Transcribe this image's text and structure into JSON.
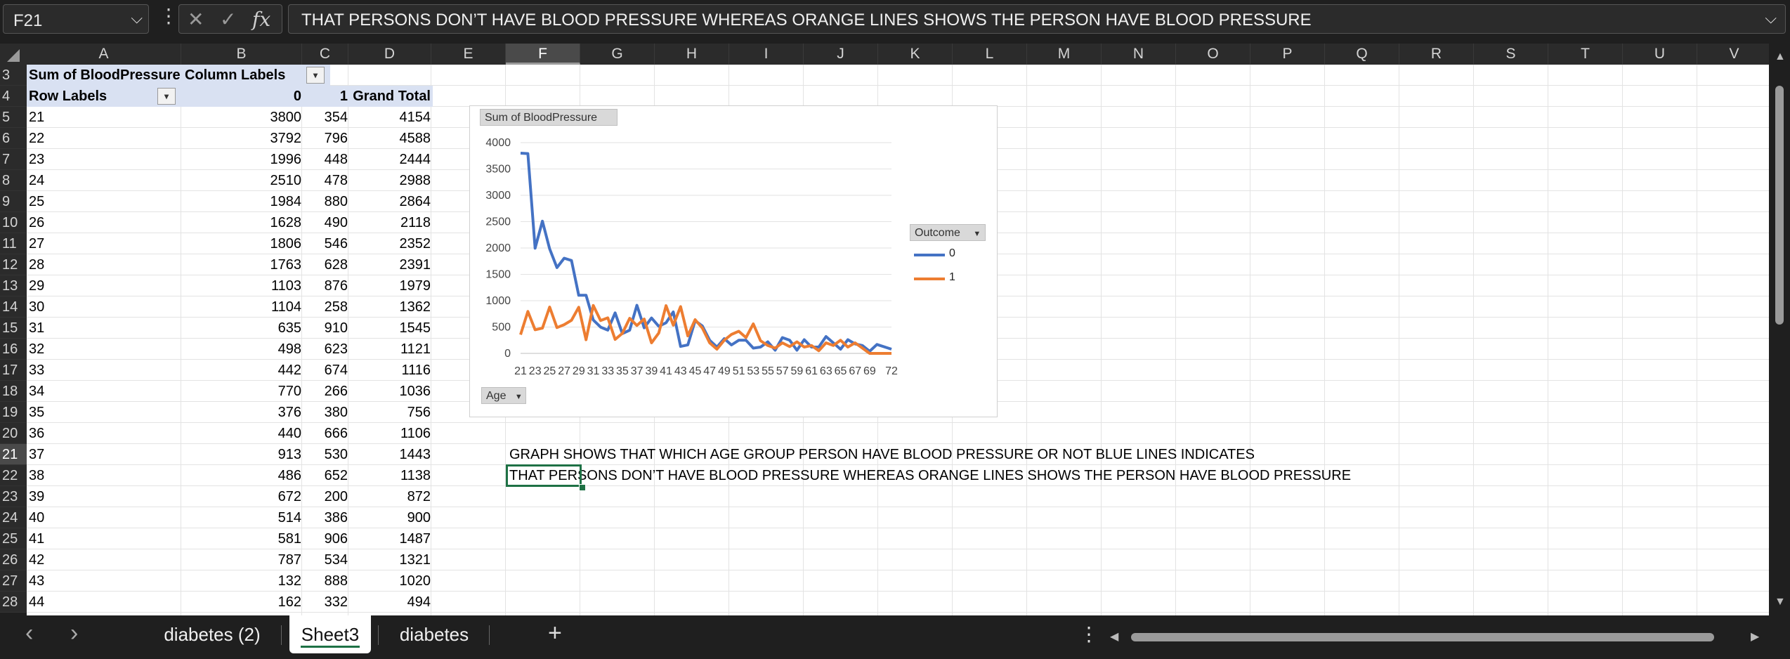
{
  "formula_bar": {
    "name_box": "F21",
    "chevron": "⌵",
    "dots": "⋮",
    "cancel_icon": "✕",
    "enter_icon": "✓",
    "fx_label": "fx",
    "formula_text": "THAT PERSONS DON’T HAVE BLOOD PRESSURE WHEREAS ORANGE LINES SHOWS THE PERSON HAVE BLOOD PRESSURE",
    "formula_chevron": "⌵"
  },
  "columns": [
    "A",
    "B",
    "C",
    "D",
    "E",
    "F",
    "G",
    "H",
    "I",
    "J",
    "K",
    "L",
    "M",
    "N",
    "O",
    "P",
    "Q",
    "R",
    "S",
    "T",
    "U",
    "V"
  ],
  "row_numbers": [
    "3",
    "4",
    "5",
    "6",
    "7",
    "8",
    "9",
    "10",
    "11",
    "12",
    "13",
    "14",
    "15",
    "16",
    "17",
    "18",
    "19",
    "20",
    "21",
    "22",
    "23",
    "24",
    "25",
    "26",
    "27",
    "28"
  ],
  "pivot": {
    "title": "Sum of BloodPressure",
    "column_labels": "Column Labels",
    "row_labels": "Row Labels",
    "col0": "0",
    "col1": "1",
    "grand_total": "Grand Total",
    "rows": [
      [
        "21",
        "3800",
        "354",
        "4154"
      ],
      [
        "22",
        "3792",
        "796",
        "4588"
      ],
      [
        "23",
        "1996",
        "448",
        "2444"
      ],
      [
        "24",
        "2510",
        "478",
        "2988"
      ],
      [
        "25",
        "1984",
        "880",
        "2864"
      ],
      [
        "26",
        "1628",
        "490",
        "2118"
      ],
      [
        "27",
        "1806",
        "546",
        "2352"
      ],
      [
        "28",
        "1763",
        "628",
        "2391"
      ],
      [
        "29",
        "1103",
        "876",
        "1979"
      ],
      [
        "30",
        "1104",
        "258",
        "1362"
      ],
      [
        "31",
        "635",
        "910",
        "1545"
      ],
      [
        "32",
        "498",
        "623",
        "1121"
      ],
      [
        "33",
        "442",
        "674",
        "1116"
      ],
      [
        "34",
        "770",
        "266",
        "1036"
      ],
      [
        "35",
        "376",
        "380",
        "756"
      ],
      [
        "36",
        "440",
        "666",
        "1106"
      ],
      [
        "37",
        "913",
        "530",
        "1443"
      ],
      [
        "38",
        "486",
        "652",
        "1138"
      ],
      [
        "39",
        "672",
        "200",
        "872"
      ],
      [
        "40",
        "514",
        "386",
        "900"
      ],
      [
        "41",
        "581",
        "906",
        "1487"
      ],
      [
        "42",
        "787",
        "534",
        "1321"
      ],
      [
        "43",
        "132",
        "888",
        "1020"
      ],
      [
        "44",
        "162",
        "332",
        "494"
      ]
    ]
  },
  "notes": {
    "line1": "GRAPH SHOWS THAT WHICH AGE GROUP PERSON HAVE BLOOD PRESSURE OR NOT BLUE LINES INDICATES",
    "line2": "THAT PERSONS DON’T HAVE BLOOD PRESSURE WHEREAS ORANGE LINES SHOWS THE PERSON HAVE BLOOD PRESSURE"
  },
  "chart_data": {
    "type": "line",
    "title": "",
    "value_field_button": "Sum of BloodPressure",
    "axis_field_button": "Age",
    "legend_field_button": "Outcome",
    "xlabel": "",
    "ylabel": "",
    "ylim": [
      0,
      4000
    ],
    "yticks": [
      "0",
      "500",
      "1000",
      "1500",
      "2000",
      "2500",
      "3000",
      "3500",
      "4000"
    ],
    "x_tick_labels": [
      "21",
      "23",
      "25",
      "27",
      "29",
      "31",
      "33",
      "35",
      "37",
      "39",
      "41",
      "43",
      "45",
      "47",
      "49",
      "51",
      "53",
      "55",
      "57",
      "59",
      "61",
      "63",
      "65",
      "67",
      "69",
      "72"
    ],
    "x": [
      21,
      22,
      23,
      24,
      25,
      26,
      27,
      28,
      29,
      30,
      31,
      32,
      33,
      34,
      35,
      36,
      37,
      38,
      39,
      40,
      41,
      42,
      43,
      44,
      45,
      46,
      47,
      48,
      49,
      50,
      51,
      52,
      53,
      54,
      55,
      56,
      57,
      58,
      59,
      60,
      61,
      62,
      63,
      64,
      65,
      66,
      67,
      68,
      69,
      70,
      72
    ],
    "grid": true,
    "legend_position": "right",
    "series": [
      {
        "name": "0",
        "color": "#4472c4",
        "values": [
          3800,
          3792,
          1996,
          2510,
          1984,
          1628,
          1806,
          1763,
          1103,
          1104,
          635,
          498,
          442,
          770,
          376,
          440,
          913,
          486,
          672,
          514,
          581,
          787,
          132,
          162,
          620,
          520,
          250,
          120,
          280,
          160,
          250,
          250,
          100,
          120,
          220,
          60,
          300,
          250,
          60,
          260,
          120,
          120,
          320,
          200,
          80,
          260,
          180,
          150,
          40,
          170,
          80
        ]
      },
      {
        "name": "1",
        "color": "#ed7d31",
        "values": [
          354,
          796,
          448,
          478,
          880,
          490,
          546,
          628,
          876,
          258,
          910,
          623,
          674,
          266,
          380,
          666,
          530,
          652,
          200,
          386,
          906,
          534,
          888,
          332,
          640,
          480,
          200,
          80,
          250,
          360,
          420,
          300,
          560,
          240,
          150,
          100,
          200,
          130,
          220,
          120,
          150,
          50,
          200,
          150,
          250,
          120,
          200,
          100,
          0,
          0,
          0
        ]
      }
    ]
  },
  "sheet_tabs": {
    "prev": "‹",
    "next": "›",
    "tabs": [
      "diabetes (2)",
      "Sheet3",
      "diabetes"
    ],
    "add": "+",
    "menu": "⋮"
  },
  "scroll": {
    "left": "◀",
    "right": "▶",
    "up": "▲",
    "down": "▼"
  },
  "colors": {
    "pivot_header_band": "#d9e1f2",
    "active_cell": "#1e7145",
    "series0": "#4472c4",
    "series1": "#ed7d31"
  }
}
